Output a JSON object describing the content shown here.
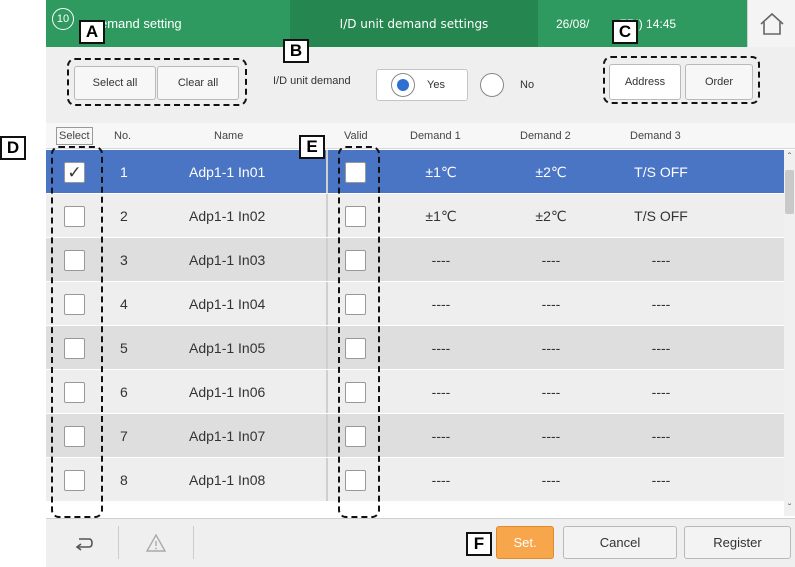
{
  "header": {
    "circle_icon_text": "10",
    "title": "emand setting",
    "screen_name": "I/D unit demand settings",
    "datetime": "26/08/",
    "datetime_tail": "FRI) 14:45"
  },
  "toolbar": {
    "select_all": "Select all",
    "clear_all": "Clear all",
    "demand_label": "I/D unit demand",
    "yes_label": "Yes",
    "no_label": "No",
    "demand_selected": "Yes",
    "address_label": "Address",
    "order_label": "Order"
  },
  "table": {
    "columns": [
      "Select",
      "No.",
      "Name",
      "Valid",
      "Demand 1",
      "Demand 2",
      "Demand 3"
    ],
    "rows": [
      {
        "select": true,
        "no": "1",
        "name": "Adp1-1 In01",
        "valid": false,
        "d1": "±1℃",
        "d2": "±2℃",
        "d3": "T/S OFF",
        "highlight": true
      },
      {
        "select": false,
        "no": "2",
        "name": "Adp1-1 In02",
        "valid": false,
        "d1": "±1℃",
        "d2": "±2℃",
        "d3": "T/S OFF",
        "highlight": false
      },
      {
        "select": false,
        "no": "3",
        "name": "Adp1-1 In03",
        "valid": false,
        "d1": "----",
        "d2": "----",
        "d3": "----",
        "highlight": false
      },
      {
        "select": false,
        "no": "4",
        "name": "Adp1-1 In04",
        "valid": false,
        "d1": "----",
        "d2": "----",
        "d3": "----",
        "highlight": false
      },
      {
        "select": false,
        "no": "5",
        "name": "Adp1-1 In05",
        "valid": false,
        "d1": "----",
        "d2": "----",
        "d3": "----",
        "highlight": false
      },
      {
        "select": false,
        "no": "6",
        "name": "Adp1-1 In06",
        "valid": false,
        "d1": "----",
        "d2": "----",
        "d3": "----",
        "highlight": false
      },
      {
        "select": false,
        "no": "7",
        "name": "Adp1-1 In07",
        "valid": false,
        "d1": "----",
        "d2": "----",
        "d3": "----",
        "highlight": false
      },
      {
        "select": false,
        "no": "8",
        "name": "Adp1-1 In08",
        "valid": false,
        "d1": "----",
        "d2": "----",
        "d3": "----",
        "highlight": false
      }
    ]
  },
  "footer": {
    "back_icon": "back-arrow-icon",
    "warning_icon": "warning-icon",
    "set_label": "Set.",
    "cancel_label": "Cancel",
    "register_label": "Register"
  },
  "callouts": {
    "a": "A",
    "b": "B",
    "c": "C",
    "d": "D",
    "e": "E",
    "f": "F"
  },
  "colors": {
    "header_green": "#2e9a5f",
    "row_highlight": "#4a74c4",
    "set_orange": "#f7a64b",
    "radio_on": "#2f6fd1"
  }
}
